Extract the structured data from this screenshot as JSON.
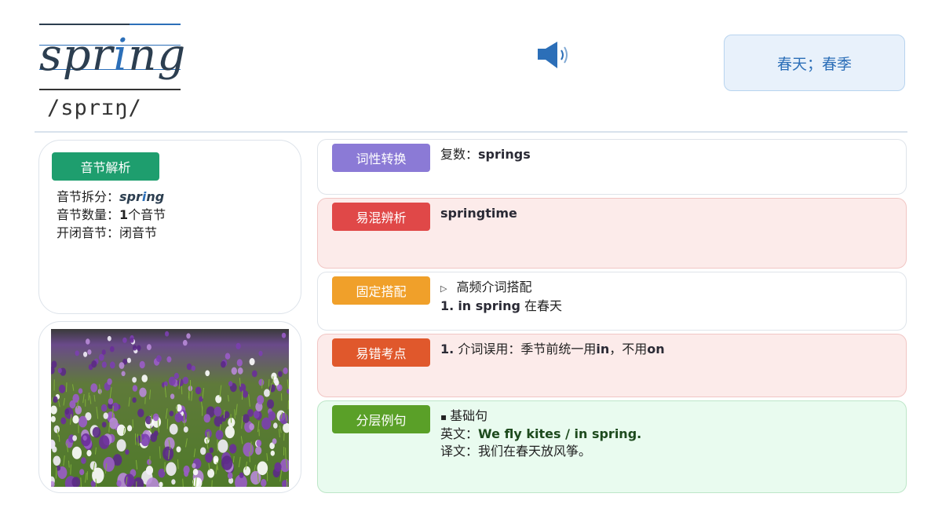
{
  "word": {
    "pre": "spr",
    "highlight": "i",
    "post": "ng",
    "phonetic": "/sprɪŋ/"
  },
  "speaker": {
    "icon": "speaker-icon"
  },
  "meaning": "春天；春季",
  "syllable": {
    "tag": "音节解析",
    "split_label": "音节拆分：",
    "split_pre": "spr",
    "split_hl": "i",
    "split_post": "ng",
    "count_label": "音节数量：",
    "count_num": "1",
    "count_unit": "个音节",
    "type_label": "开闭音节：",
    "type_value": "闭音节"
  },
  "image": {
    "alt": "spring crocus flowers"
  },
  "rows": {
    "pos": {
      "tag": "词性转换",
      "label": "复数：",
      "value": "springs"
    },
    "confuse": {
      "tag": "易混辨析",
      "value": "springtime"
    },
    "collocation": {
      "tag": "固定搭配",
      "bullet": "▷",
      "heading": "高频介词搭配",
      "num": "1.",
      "phrase": "in spring",
      "meaning": "在春天"
    },
    "error": {
      "tag": "易错考点",
      "num": "1.",
      "text_pre": "介词误用：季节前统一用",
      "use": "in",
      "text_mid": "，不用",
      "avoid": "on"
    },
    "example": {
      "tag": "分层例句",
      "bullet": "▪",
      "level": "基础句",
      "en_label": "英文：",
      "en": "We fly kites / in spring.",
      "zh_label": "译文：",
      "zh": "我们在春天放风筝。"
    }
  },
  "colors": {
    "accent_blue": "#2c6fb8",
    "tag_syllable": "#1e9e6e",
    "tag_pos": "#8b7ad6",
    "tag_confuse": "#e04848",
    "tag_collocation": "#f0a02a",
    "tag_error": "#e0582c",
    "tag_example": "#5aa028"
  }
}
